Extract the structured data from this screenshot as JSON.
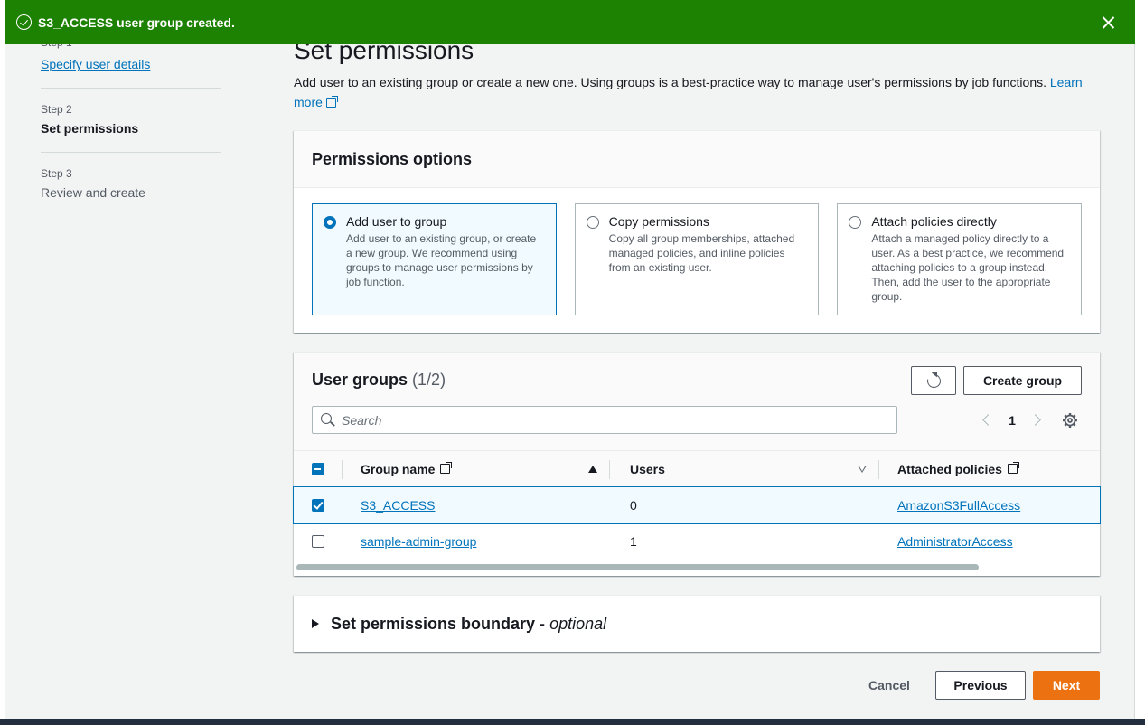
{
  "colors": {
    "success": "#1d8102",
    "link": "#0073bb",
    "primary_button": "#ec7211",
    "selected_bg": "#f1faff"
  },
  "flash": {
    "message": "S3_ACCESS user group created.",
    "icon": "check-circle-icon",
    "dismiss_icon": "close-icon"
  },
  "stepper": {
    "steps": [
      {
        "label": "Step 1",
        "title": "Specify user details"
      },
      {
        "label": "Step 2",
        "title": "Set permissions"
      },
      {
        "label": "Step 3",
        "title": "Review and create"
      }
    ]
  },
  "page": {
    "title": "Set permissions",
    "description": "Add user to an existing group or create a new one. Using groups is a best-practice way to manage user's permissions by job functions. ",
    "learn_more": "Learn more"
  },
  "permissions_options": {
    "title": "Permissions options",
    "options": [
      {
        "title": "Add user to group",
        "description": "Add user to an existing group, or create a new group. We recommend using groups to manage user permissions by job function.",
        "selected": true
      },
      {
        "title": "Copy permissions",
        "description": "Copy all group memberships, attached managed policies, and inline policies from an existing user.",
        "selected": false
      },
      {
        "title": "Attach policies directly",
        "description": "Attach a managed policy directly to a user. As a best practice, we recommend attaching policies to a group instead. Then, add the user to the appropriate group.",
        "selected": false
      }
    ]
  },
  "user_groups": {
    "title": "User groups",
    "count": "(1/2)",
    "create_label": "Create group",
    "search_placeholder": "Search",
    "page": "1",
    "columns": {
      "group_name": "Group name",
      "users": "Users",
      "attached_policies": "Attached policies"
    },
    "rows": [
      {
        "name": "S3_ACCESS",
        "users": "0",
        "policies": "AmazonS3FullAccess",
        "checked": true
      },
      {
        "name": "sample-admin-group",
        "users": "1",
        "policies": "AdministratorAccess",
        "checked": false
      }
    ]
  },
  "boundary": {
    "title": "Set permissions boundary - ",
    "optional": "optional"
  },
  "footer": {
    "cancel": "Cancel",
    "previous": "Previous",
    "next": "Next"
  }
}
